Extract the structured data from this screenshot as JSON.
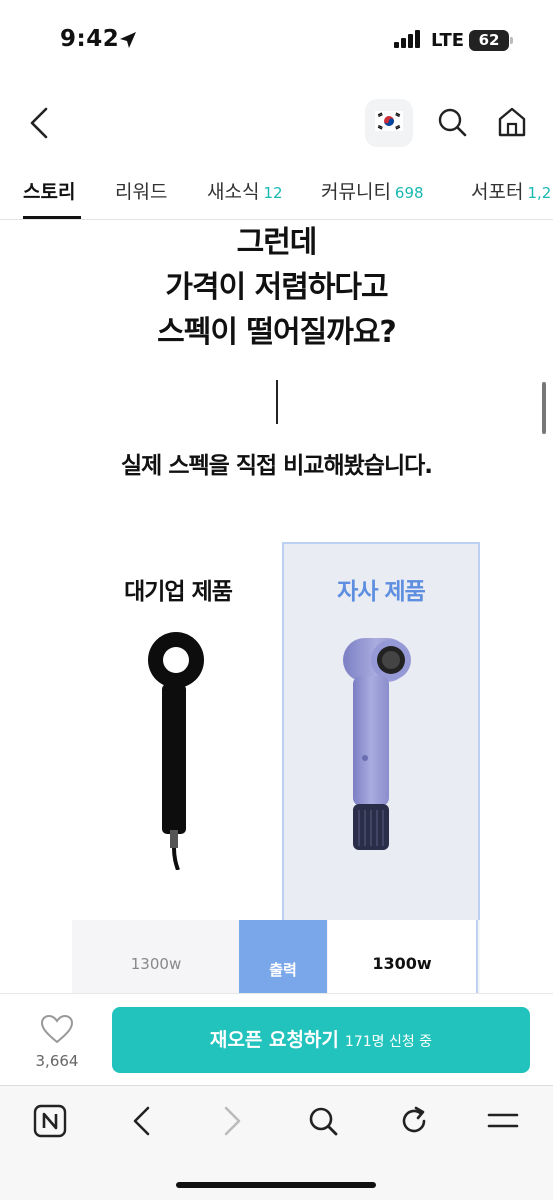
{
  "status_bar": {
    "time": "9:42",
    "network": "LTE",
    "battery": "62"
  },
  "tabs": [
    {
      "label": "스토리",
      "count": ""
    },
    {
      "label": "리워드",
      "count": ""
    },
    {
      "label": "새소식",
      "count": "12"
    },
    {
      "label": "커뮤니티",
      "count": "698"
    },
    {
      "label": "서포터",
      "count": "1,2"
    }
  ],
  "content": {
    "headline_line1": "그런데",
    "headline_line2": "가격이 저렴하다고",
    "headline_line3": "스펙이 떨어질까요?",
    "subheadline": "실제 스펙을 직접 비교해봤습니다.",
    "compare": {
      "left_title": "대기업 제품",
      "right_title": "자사 제품",
      "spec_label": "출력",
      "left_value": "1300w",
      "right_value": "1300w"
    }
  },
  "action_bar": {
    "like_count": "3,664",
    "cta_label": "재오픈 요청하기",
    "cta_sub": "171명 신청 중"
  },
  "colors": {
    "accent_teal": "#23c3bd",
    "tab_count": "#19b9b1",
    "product_blue": "#5d8ee0",
    "spec_label_bg": "#7aa7ea"
  },
  "icons": {
    "back": "chevron-left-icon",
    "language": "korea-flag-icon",
    "search": "search-icon",
    "home": "home-icon",
    "like": "heart-icon"
  }
}
